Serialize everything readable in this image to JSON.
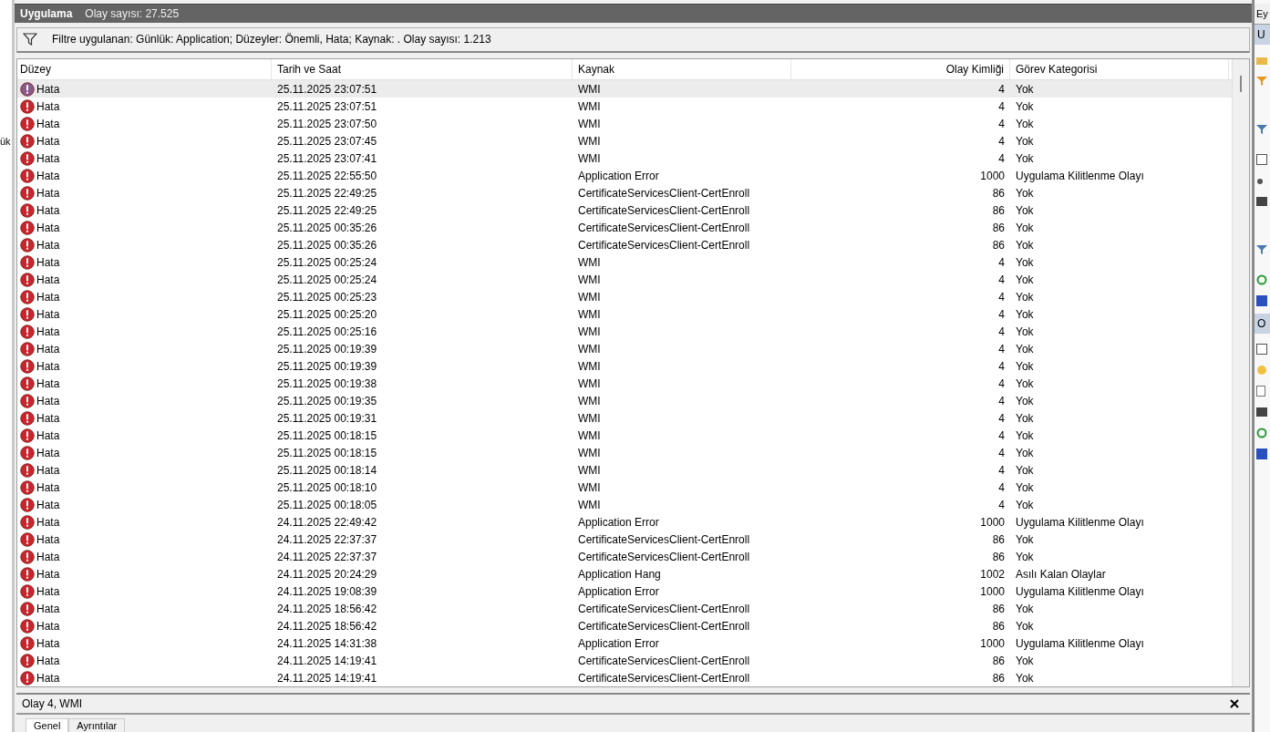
{
  "left_strip": {
    "text": "ük"
  },
  "title_bar": {
    "title": "Uygulama",
    "count": "Olay sayısı: 27.525"
  },
  "filter_bar": {
    "text": "Filtre uygulanan: Günlük: Application; Düzeyler: Önemli, Hata; Kaynak: . Olay sayısı: 1.213"
  },
  "table": {
    "columns": [
      "Düzey",
      "Tarih ve Saat",
      "Kaynak",
      "Olay Kimliği",
      "Görev Kategorisi"
    ],
    "rows": [
      {
        "level": "Hata",
        "date": "25.11.2025 23:07:51",
        "source": "WMI",
        "id": "4",
        "category": "Yok",
        "selected": true
      },
      {
        "level": "Hata",
        "date": "25.11.2025 23:07:51",
        "source": "WMI",
        "id": "4",
        "category": "Yok",
        "selected": false
      },
      {
        "level": "Hata",
        "date": "25.11.2025 23:07:50",
        "source": "WMI",
        "id": "4",
        "category": "Yok",
        "selected": false
      },
      {
        "level": "Hata",
        "date": "25.11.2025 23:07:45",
        "source": "WMI",
        "id": "4",
        "category": "Yok",
        "selected": false
      },
      {
        "level": "Hata",
        "date": "25.11.2025 23:07:41",
        "source": "WMI",
        "id": "4",
        "category": "Yok",
        "selected": false
      },
      {
        "level": "Hata",
        "date": "25.11.2025 22:55:50",
        "source": "Application Error",
        "id": "1000",
        "category": "Uygulama Kilitlenme Olayı",
        "selected": false
      },
      {
        "level": "Hata",
        "date": "25.11.2025 22:49:25",
        "source": "CertificateServicesClient-CertEnroll",
        "id": "86",
        "category": "Yok",
        "selected": false
      },
      {
        "level": "Hata",
        "date": "25.11.2025 22:49:25",
        "source": "CertificateServicesClient-CertEnroll",
        "id": "86",
        "category": "Yok",
        "selected": false
      },
      {
        "level": "Hata",
        "date": "25.11.2025 00:35:26",
        "source": "CertificateServicesClient-CertEnroll",
        "id": "86",
        "category": "Yok",
        "selected": false
      },
      {
        "level": "Hata",
        "date": "25.11.2025 00:35:26",
        "source": "CertificateServicesClient-CertEnroll",
        "id": "86",
        "category": "Yok",
        "selected": false
      },
      {
        "level": "Hata",
        "date": "25.11.2025 00:25:24",
        "source": "WMI",
        "id": "4",
        "category": "Yok",
        "selected": false
      },
      {
        "level": "Hata",
        "date": "25.11.2025 00:25:24",
        "source": "WMI",
        "id": "4",
        "category": "Yok",
        "selected": false
      },
      {
        "level": "Hata",
        "date": "25.11.2025 00:25:23",
        "source": "WMI",
        "id": "4",
        "category": "Yok",
        "selected": false
      },
      {
        "level": "Hata",
        "date": "25.11.2025 00:25:20",
        "source": "WMI",
        "id": "4",
        "category": "Yok",
        "selected": false
      },
      {
        "level": "Hata",
        "date": "25.11.2025 00:25:16",
        "source": "WMI",
        "id": "4",
        "category": "Yok",
        "selected": false
      },
      {
        "level": "Hata",
        "date": "25.11.2025 00:19:39",
        "source": "WMI",
        "id": "4",
        "category": "Yok",
        "selected": false
      },
      {
        "level": "Hata",
        "date": "25.11.2025 00:19:39",
        "source": "WMI",
        "id": "4",
        "category": "Yok",
        "selected": false
      },
      {
        "level": "Hata",
        "date": "25.11.2025 00:19:38",
        "source": "WMI",
        "id": "4",
        "category": "Yok",
        "selected": false
      },
      {
        "level": "Hata",
        "date": "25.11.2025 00:19:35",
        "source": "WMI",
        "id": "4",
        "category": "Yok",
        "selected": false
      },
      {
        "level": "Hata",
        "date": "25.11.2025 00:19:31",
        "source": "WMI",
        "id": "4",
        "category": "Yok",
        "selected": false
      },
      {
        "level": "Hata",
        "date": "25.11.2025 00:18:15",
        "source": "WMI",
        "id": "4",
        "category": "Yok",
        "selected": false
      },
      {
        "level": "Hata",
        "date": "25.11.2025 00:18:15",
        "source": "WMI",
        "id": "4",
        "category": "Yok",
        "selected": false
      },
      {
        "level": "Hata",
        "date": "25.11.2025 00:18:14",
        "source": "WMI",
        "id": "4",
        "category": "Yok",
        "selected": false
      },
      {
        "level": "Hata",
        "date": "25.11.2025 00:18:10",
        "source": "WMI",
        "id": "4",
        "category": "Yok",
        "selected": false
      },
      {
        "level": "Hata",
        "date": "25.11.2025 00:18:05",
        "source": "WMI",
        "id": "4",
        "category": "Yok",
        "selected": false
      },
      {
        "level": "Hata",
        "date": "24.11.2025 22:49:42",
        "source": "Application Error",
        "id": "1000",
        "category": "Uygulama Kilitlenme Olayı",
        "selected": false
      },
      {
        "level": "Hata",
        "date": "24.11.2025 22:37:37",
        "source": "CertificateServicesClient-CertEnroll",
        "id": "86",
        "category": "Yok",
        "selected": false
      },
      {
        "level": "Hata",
        "date": "24.11.2025 22:37:37",
        "source": "CertificateServicesClient-CertEnroll",
        "id": "86",
        "category": "Yok",
        "selected": false
      },
      {
        "level": "Hata",
        "date": "24.11.2025 20:24:29",
        "source": "Application Hang",
        "id": "1002",
        "category": "Asılı Kalan Olaylar",
        "selected": false
      },
      {
        "level": "Hata",
        "date": "24.11.2025 19:08:39",
        "source": "Application Error",
        "id": "1000",
        "category": "Uygulama Kilitlenme Olayı",
        "selected": false
      },
      {
        "level": "Hata",
        "date": "24.11.2025 18:56:42",
        "source": "CertificateServicesClient-CertEnroll",
        "id": "86",
        "category": "Yok",
        "selected": false
      },
      {
        "level": "Hata",
        "date": "24.11.2025 18:56:42",
        "source": "CertificateServicesClient-CertEnroll",
        "id": "86",
        "category": "Yok",
        "selected": false
      },
      {
        "level": "Hata",
        "date": "24.11.2025 14:31:38",
        "source": "Application Error",
        "id": "1000",
        "category": "Uygulama Kilitlenme Olayı",
        "selected": false
      },
      {
        "level": "Hata",
        "date": "24.11.2025 14:19:41",
        "source": "CertificateServicesClient-CertEnroll",
        "id": "86",
        "category": "Yok",
        "selected": false
      },
      {
        "level": "Hata",
        "date": "24.11.2025 14:19:41",
        "source": "CertificateServicesClient-CertEnroll",
        "id": "86",
        "category": "Yok",
        "selected": false
      }
    ]
  },
  "detail_pane": {
    "title": "Olay 4, WMI",
    "tabs": [
      {
        "label": "Genel",
        "selected": true
      },
      {
        "label": "Ayrıntılar",
        "selected": false
      }
    ]
  },
  "actions_pane": {
    "header": "Ey",
    "sections": [
      {
        "title": "U"
      },
      {
        "title": "O"
      }
    ]
  }
}
